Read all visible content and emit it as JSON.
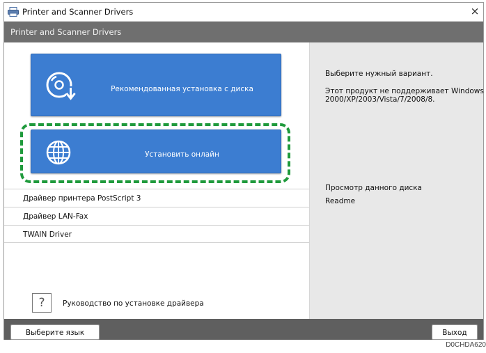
{
  "window": {
    "title": "Printer and Scanner Drivers",
    "close_glyph": "×",
    "header": "Printer and Scanner Drivers"
  },
  "buttons": {
    "install_disc": "Рекомендованная установка с диска",
    "install_online": "Установить онлайн"
  },
  "drivers": [
    "Драйвер принтера PostScript 3",
    "Драйвер LAN-Fax",
    "TWAIN Driver"
  ],
  "guide": {
    "icon_glyph": "?",
    "label": "Руководство по установке драйвера"
  },
  "info": {
    "prompt": "Выберите нужный вариант.",
    "notice": [
      "Этот продукт не поддерживает Windows",
      "2000/XP/2003/Vista/7/2008/8."
    ],
    "browse": "Просмотр данного диска",
    "readme": "Readme"
  },
  "footer": {
    "language_button": "Выберите язык",
    "exit_button": "Выход"
  },
  "figure_code": "D0CHDA620",
  "colors": {
    "accent_blue": "#3c7dd1",
    "highlight_green": "#1f9a3c",
    "header_gray": "#6f6f6f",
    "footer_gray": "#5f5f5f"
  },
  "icons": [
    "printer-icon",
    "close-icon",
    "disc-download-icon",
    "globe-icon",
    "help-question-icon"
  ]
}
